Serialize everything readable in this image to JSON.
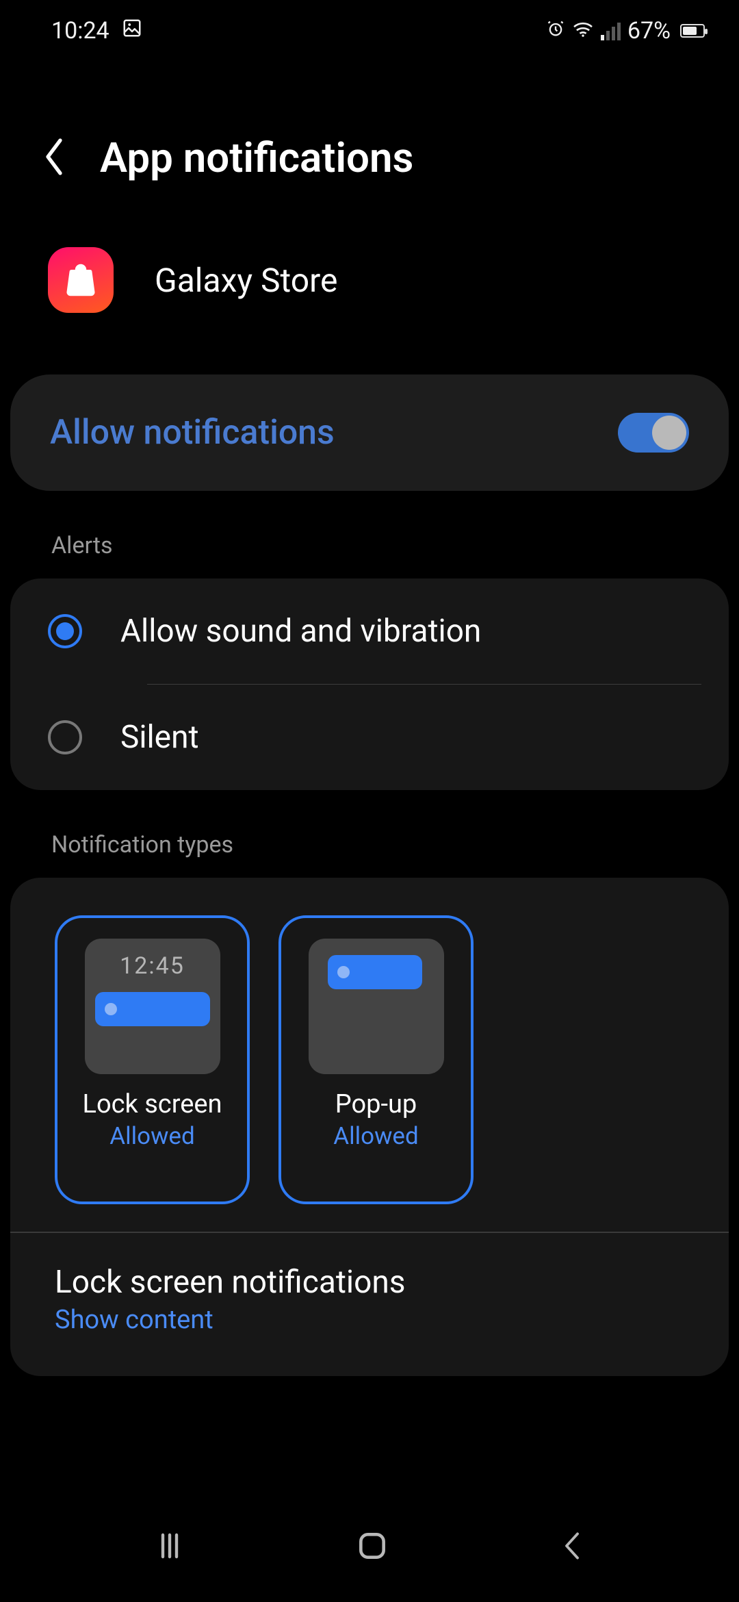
{
  "status": {
    "time": "10:24",
    "battery_pct": "67%"
  },
  "header": {
    "title": "App notifications"
  },
  "app": {
    "name": "Galaxy Store"
  },
  "allow": {
    "label": "Allow notifications",
    "enabled": true
  },
  "sections": {
    "alerts": "Alerts",
    "types": "Notification types"
  },
  "alerts": {
    "sound_vibration": "Allow sound and vibration",
    "silent": "Silent",
    "selected": "sound_vibration"
  },
  "types": {
    "lock_screen": {
      "name": "Lock screen",
      "status": "Allowed",
      "preview_time": "12:45"
    },
    "popup": {
      "name": "Pop-up",
      "status": "Allowed"
    }
  },
  "lockscreen_setting": {
    "title": "Lock screen notifications",
    "subtitle": "Show content"
  }
}
